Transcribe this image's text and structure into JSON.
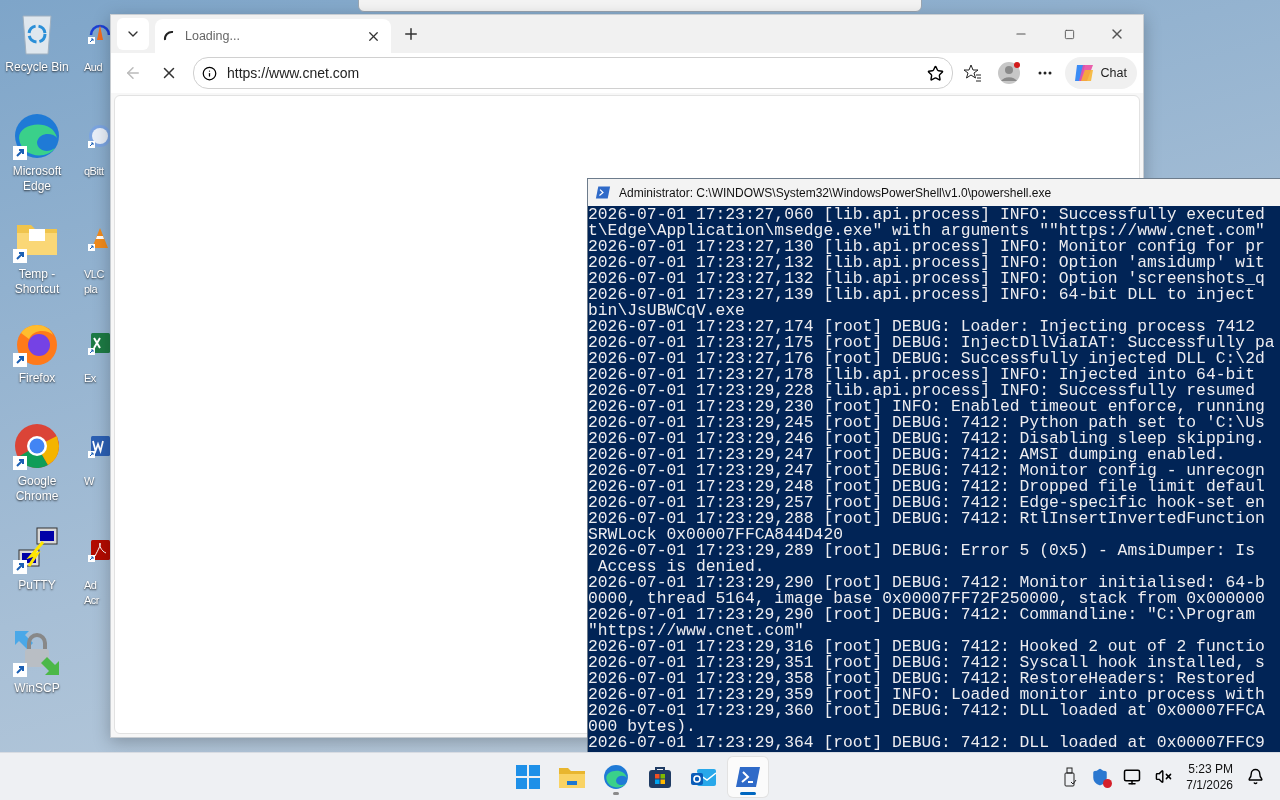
{
  "desktop_icons": [
    {
      "kind": "recycle",
      "label": "Recycle Bin"
    },
    {
      "kind": "edge",
      "label": "Microsoft Edge"
    },
    {
      "kind": "folder",
      "label": "Temp - Shortcut"
    },
    {
      "kind": "firefox",
      "label": "Firefox"
    },
    {
      "kind": "chrome",
      "label": "Google Chrome"
    },
    {
      "kind": "putty",
      "label": "PuTTY"
    },
    {
      "kind": "winscp",
      "label": "WinSCP"
    }
  ],
  "desktop_icons_partial": [
    {
      "kind": "audio",
      "label": "Aud"
    },
    {
      "kind": "torrent",
      "label": "qBitt"
    },
    {
      "kind": "cone",
      "label": "VLC\npla"
    },
    {
      "kind": "excel",
      "label": "Ex"
    },
    {
      "kind": "word",
      "label": "W"
    },
    {
      "kind": "pdf",
      "label": "Ad\nAcr"
    }
  ],
  "browser": {
    "tab": {
      "title": "Loading...",
      "selected": true
    },
    "url": "https://www.cnet.com",
    "chat_label": "Chat"
  },
  "console": {
    "title": "Administrator: C:\\WINDOWS\\System32\\WindowsPowerShell\\v1.0\\powershell.exe",
    "lines": [
      "2026-07-01 17:23:27,060 [lib.api.process] INFO: Successfully executed",
      "t\\Edge\\Application\\msedge.exe\" with arguments \"\"https://www.cnet.com\"",
      "2026-07-01 17:23:27,130 [lib.api.process] INFO: Monitor config for pr",
      "2026-07-01 17:23:27,132 [lib.api.process] INFO: Option 'amsidump' wit",
      "2026-07-01 17:23:27,132 [lib.api.process] INFO: Option 'screenshots_q",
      "2026-07-01 17:23:27,139 [lib.api.process] INFO: 64-bit DLL to inject",
      "bin\\JsUBWCqV.exe",
      "2026-07-01 17:23:27,174 [root] DEBUG: Loader: Injecting process 7412",
      "2026-07-01 17:23:27,175 [root] DEBUG: InjectDllViaIAT: Successfully pa",
      "2026-07-01 17:23:27,176 [root] DEBUG: Successfully injected DLL C:\\2d",
      "2026-07-01 17:23:27,178 [lib.api.process] INFO: Injected into 64-bit",
      "2026-07-01 17:23:29,228 [lib.api.process] INFO: Successfully resumed",
      "2026-07-01 17:23:29,230 [root] INFO: Enabled timeout enforce, running",
      "2026-07-01 17:23:29,245 [root] DEBUG: 7412: Python path set to 'C:\\Us",
      "2026-07-01 17:23:29,246 [root] DEBUG: 7412: Disabling sleep skipping.",
      "2026-07-01 17:23:29,247 [root] DEBUG: 7412: AMSI dumping enabled.",
      "2026-07-01 17:23:29,247 [root] DEBUG: 7412: Monitor config - unrecogn",
      "2026-07-01 17:23:29,248 [root] DEBUG: 7412: Dropped file limit defaul",
      "2026-07-01 17:23:29,257 [root] DEBUG: 7412: Edge-specific hook-set en",
      "2026-07-01 17:23:29,288 [root] DEBUG: 7412: RtlInsertInvertedFunction",
      "SRWLock 0x00007FFCA844D420",
      "2026-07-01 17:23:29,289 [root] DEBUG: Error 5 (0x5) - AmsiDumper: Is",
      " Access is denied.",
      "2026-07-01 17:23:29,290 [root] DEBUG: 7412: Monitor initialised: 64-b",
      "0000, thread 5164, image base 0x00007FF72F250000, stack from 0x000000",
      "2026-07-01 17:23:29,290 [root] DEBUG: 7412: Commandline: \"C:\\Program",
      "\"https://www.cnet.com\"",
      "2026-07-01 17:23:29,316 [root] DEBUG: 7412: Hooked 2 out of 2 functio",
      "2026-07-01 17:23:29,351 [root] DEBUG: 7412: Syscall hook installed, s",
      "2026-07-01 17:23:29,358 [root] DEBUG: 7412: RestoreHeaders: Restored",
      "2026-07-01 17:23:29,359 [root] INFO: Loaded monitor into process with",
      "2026-07-01 17:23:29,360 [root] DEBUG: 7412: DLL loaded at 0x00007FFCA",
      "000 bytes).",
      "2026-07-01 17:23:29,364 [root] DEBUG: 7412: DLL loaded at 0x00007FFC9"
    ]
  },
  "taskbar": {
    "apps": [
      {
        "kind": "start",
        "selected": false
      },
      {
        "kind": "explorer",
        "selected": false
      },
      {
        "kind": "edge",
        "selected": false
      },
      {
        "kind": "store",
        "selected": false
      },
      {
        "kind": "outlook",
        "selected": false
      },
      {
        "kind": "powershell",
        "selected": true
      }
    ],
    "time": "5:23 PM",
    "date": "7/1/2026"
  }
}
